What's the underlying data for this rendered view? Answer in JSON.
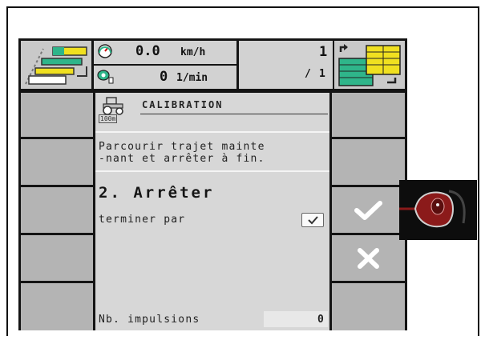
{
  "header": {
    "speed_value": "0.0",
    "speed_unit": "km/h",
    "rpm_value": "0",
    "rpm_unit": "1/min",
    "counter_top": "1",
    "counter_bottom": "1",
    "counter_prefix": "/"
  },
  "dialog": {
    "title": "CALIBRATION",
    "tractor_caption": "100m",
    "instruction_line1": "Parcourir trajet mainte",
    "instruction_line2": "-nant et arrêter à fin.",
    "step_title": "2. Arrêter",
    "finish_label": "terminer par",
    "impulses_label": "Nb. impulsions",
    "impulses_value": "0"
  },
  "icons": {
    "speed": "speedometer-icon",
    "rpm": "rpm-sensor-icon",
    "tractor": "tractor-icon",
    "confirm": "checkmark-icon",
    "cancel": "cross-icon",
    "joystick": "joystick-button-icon"
  },
  "colors": {
    "accent_green": "#2fb58a",
    "accent_yellow": "#f0e020",
    "joystick_red": "#8b1a1a"
  }
}
